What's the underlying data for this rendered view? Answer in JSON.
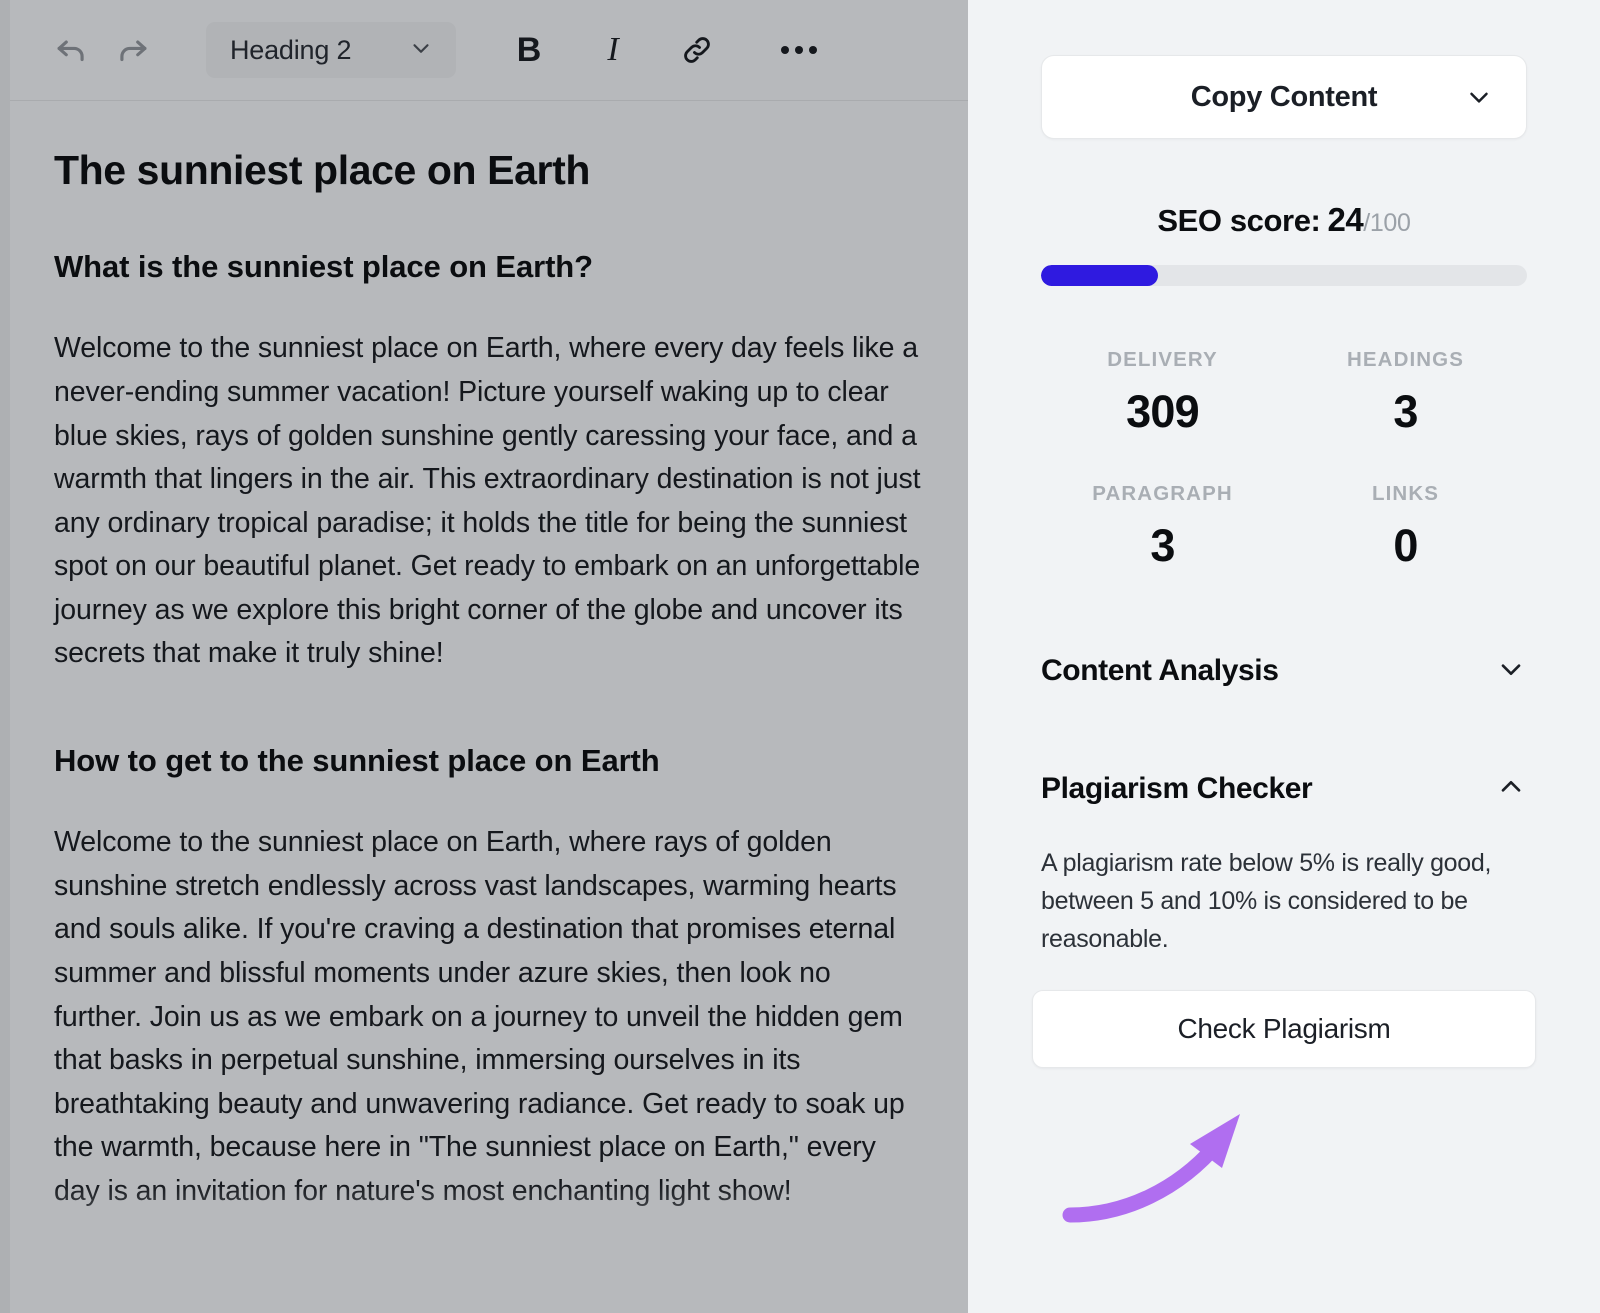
{
  "editor": {
    "toolbar": {
      "undo_icon": "undo-arrow-icon",
      "redo_icon": "redo-arrow-icon",
      "style_select_value": "Heading 2",
      "chevron_icon": "chevron-down-icon",
      "bold_label": "B",
      "italic_label": "I",
      "link_icon": "link-chain-icon",
      "more_icon": "more-horizontal-icon"
    },
    "document": {
      "title": "The sunniest place on Earth",
      "section_1_heading": "What is the sunniest place on Earth?",
      "section_1_paragraph": "Welcome to the sunniest place on Earth, where every day feels like a never-ending summer vacation! Picture yourself waking up to clear blue skies, rays of golden sunshine gently caressing your face, and a warmth that lingers in the air. This extraordinary destination is not just any ordinary tropical paradise; it holds the title for being the sunniest spot on our beautiful planet. Get ready to embark on an unforgettable journey as we explore this bright corner of the globe and uncover its secrets that make it truly shine!",
      "section_2_heading": "How to get to the sunniest place on Earth",
      "section_2_paragraph": "Welcome to the sunniest place on Earth, where rays of golden sunshine stretch endlessly across vast landscapes, warming hearts and souls alike. If you're craving a destination that promises eternal summer and blissful moments under azure skies, then look no further. Join us as we embark on a journey to unveil the hidden gem that basks in perpetual sunshine, immersing ourselves in its breathtaking beauty and unwavering radiance. Get ready to soak up the warmth, because here in \"The sunniest place on Earth,\" every day is an invitation for nature's most enchanting light show!"
    }
  },
  "panel": {
    "copy_content": {
      "label": "Copy Content",
      "chevron_icon": "chevron-down-icon"
    },
    "seo_score": {
      "label": "SEO score:",
      "value": "24",
      "max": "/100",
      "percent": 24,
      "bar_color": "#2f1ae0",
      "track_color": "#e3e5e8"
    },
    "metrics": [
      {
        "label": "DELIVERY",
        "value": "309"
      },
      {
        "label": "HEADINGS",
        "value": "3"
      },
      {
        "label": "PARAGRAPH",
        "value": "3"
      },
      {
        "label": "LINKS",
        "value": "0"
      }
    ],
    "sections": [
      {
        "title": "Content Analysis",
        "state": "collapsed",
        "chevron_icon": "chevron-down-icon"
      },
      {
        "title": "Plagiarism Checker",
        "state": "expanded",
        "chevron_icon": "chevron-up-icon"
      }
    ],
    "plagiarism": {
      "description": "A plagiarism rate below 5% is really good, between 5 and 10% is considered to be reasonable.",
      "button_label": "Check Plagiarism"
    },
    "annotation": {
      "arrow_icon": "curved-arrow-up-right-icon",
      "color": "#b06ef0"
    }
  }
}
